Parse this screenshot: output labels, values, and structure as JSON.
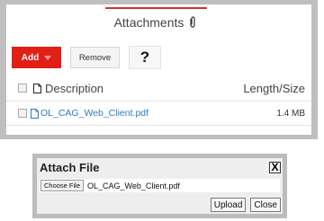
{
  "attachments_panel": {
    "tab_label": "Attachments",
    "tab_icon": "paperclip-icon",
    "accent_color": "#d7302b",
    "toolbar": {
      "add_label": "Add",
      "remove_label": "Remove",
      "help_label": "?"
    },
    "table": {
      "headers": {
        "description": "Description",
        "length_size": "Length/Size"
      },
      "rows": [
        {
          "name": "OL_CAG_Web_Client.pdf",
          "size": "1.4 MB"
        }
      ]
    }
  },
  "attach_file_dialog": {
    "title": "Attach File",
    "close_label": "X",
    "choose_file_label": "Choose File",
    "selected_file": "OL_CAG_Web_Client.pdf",
    "upload_label": "Upload",
    "close_button_label": "Close"
  }
}
